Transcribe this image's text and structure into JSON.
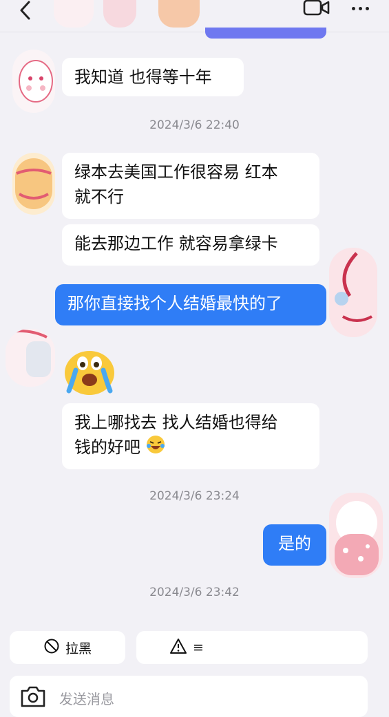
{
  "header": {
    "back_icon": "chevron-left-icon",
    "video_icon": "video-icon",
    "more_icon": "more-dots-icon"
  },
  "messages": [
    {
      "side": "in",
      "text": "我知道 也得等十年"
    },
    {
      "timestamp": "2024/3/6 22:40"
    },
    {
      "side": "in",
      "text_lines": [
        "绿本去美国工作很容易 红本",
        "就不行"
      ]
    },
    {
      "side": "in",
      "text": "能去那边工作 就容易拿绿卡"
    },
    {
      "side": "out",
      "text": "那你直接找个人结婚最快的了"
    },
    {
      "side": "in",
      "emoji": "crying-face-emoji"
    },
    {
      "side": "in",
      "text_lines": [
        "我上哪找去 找人结婚也得给",
        "钱的好吧"
      ],
      "trailing_emoji": "laughing-crying-emoji"
    },
    {
      "timestamp": "2024/3/6 23:24"
    },
    {
      "side": "out",
      "text": "是的"
    },
    {
      "timestamp": "2024/3/6 23:42"
    }
  ],
  "actions": {
    "block_label": "拉黑",
    "report_symbol": "≡"
  },
  "composer": {
    "placeholder": "发送消息",
    "camera_icon": "camera-icon"
  },
  "colors": {
    "background": "#f2f1f6",
    "outgoing_bubble": "#2f7df6",
    "incoming_bubble": "#ffffff"
  }
}
